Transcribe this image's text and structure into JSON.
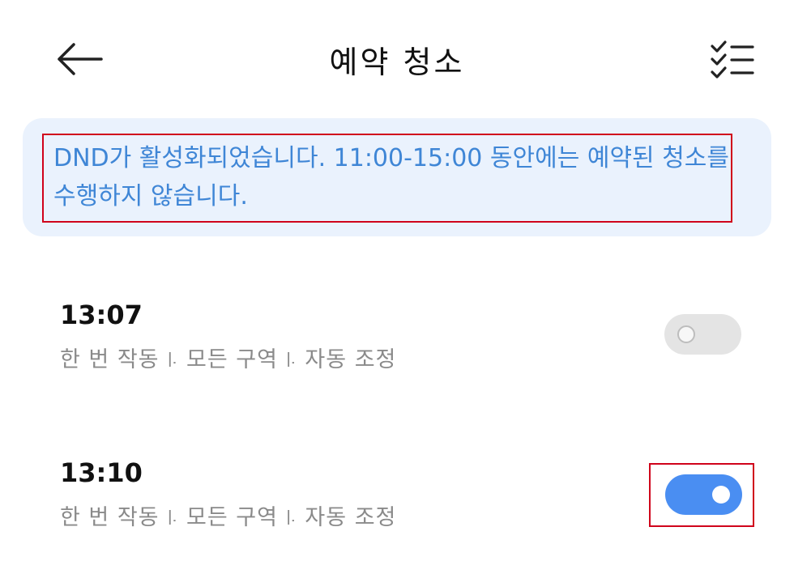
{
  "header": {
    "title": "예약 청소",
    "back_icon": "arrow-left-icon",
    "select_icon": "checklist-icon"
  },
  "banner": {
    "message": "DND가 활성화되었습니다. 11:00-15:00 동안에는 예약된 청소를 수행하지 않습니다."
  },
  "schedules": [
    {
      "time": "13:07",
      "description": "한 번 작동 ꜐ 모든 구역 ꜐ 자동 조정",
      "enabled": false
    },
    {
      "time": "13:10",
      "description": "한 번 작동 ꜐ 모든 구역 ꜐ 자동 조정",
      "enabled": true
    }
  ],
  "colors": {
    "accent": "#4a8ef2",
    "banner_bg": "#eaf2fd",
    "banner_text": "#3f86d6",
    "highlight": "#d0021b"
  }
}
